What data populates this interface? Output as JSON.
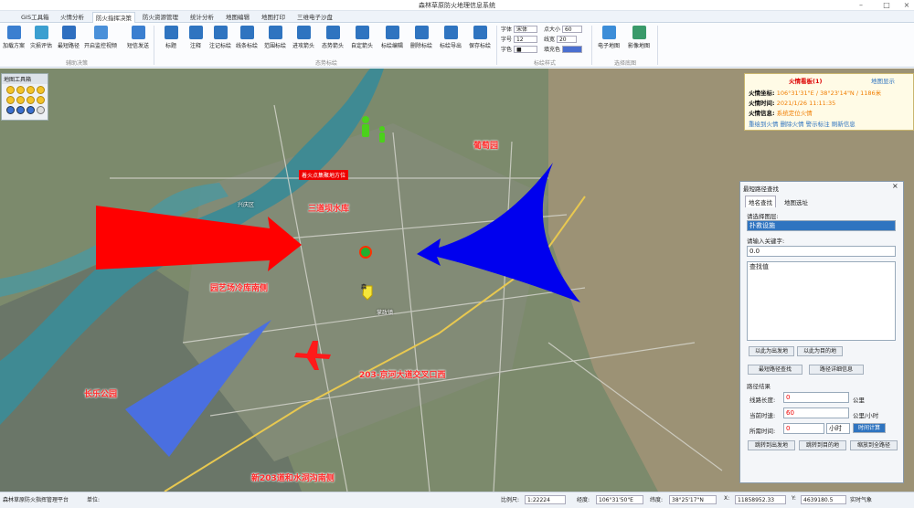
{
  "app_title": "森林草原防火地理信息系统",
  "tabs": [
    "GIS工具箱",
    "火情分析",
    "防火指挥决策",
    "防火资源管理",
    "统计分析",
    "地图编辑",
    "地图打印",
    "三维电子沙盘"
  ],
  "active_tab": 2,
  "ribbon": {
    "groups": [
      {
        "name": "辅助决策",
        "buttons": [
          "加载方案",
          "灾损评估",
          "最短路径",
          "开启监控视频",
          "短信发送"
        ]
      },
      {
        "name": "态势标绘",
        "buttons": [
          "标题",
          "注释",
          "注记标绘",
          "线条标绘",
          "范围标绘",
          "进攻箭头",
          "态势箭头",
          "自定箭头",
          "标绘编辑",
          "删除标绘",
          "标绘导出",
          "保存标绘"
        ]
      },
      {
        "name": "标绘样式",
        "fields": [
          {
            "label": "字体",
            "value": "宋体"
          },
          {
            "label": "字号",
            "value": "12"
          },
          {
            "label": "字色",
            "value": "■"
          },
          {
            "label": "点大小",
            "value": "60"
          },
          {
            "label": "线宽",
            "value": "20"
          },
          {
            "label": "填充色",
            "value": ""
          }
        ]
      },
      {
        "name": "选择底图",
        "buttons": [
          "电子地图",
          "影像地图"
        ]
      }
    ]
  },
  "toolbox_title": "地图工具箱",
  "map_labels": {
    "fire_alert": "着火点集聚地方位",
    "grape": "葡萄园",
    "reservoir": "三道坝水库",
    "garden_south": "园艺场冷库南侧",
    "intersection": "203-京河大道交叉口西",
    "park": "长乐公园",
    "new203": "新203道和水洞沟南侧",
    "district": "兴庆区",
    "town": "掌政镇",
    "forest_badge": "森"
  },
  "fire_info": {
    "title": "火情看板(1)",
    "link": "地图显示",
    "coord_label": "火情坐标:",
    "coord_value": "106°31'31\"E / 38°23'14\"N / 1186米",
    "time_label": "火情时间:",
    "time_value": "2021/1/26 11:11:35",
    "info_label": "火情信息:",
    "info_value": "系统定位火情",
    "actions": [
      "重绘到火情",
      "删除火情",
      "警示标注",
      "刷新信息"
    ]
  },
  "path_dialog": {
    "title": "最短路径查找",
    "tabs": [
      "地名查找",
      "地图选址"
    ],
    "layer_label": "请选择图层:",
    "layer_value": "扑救设施",
    "keyword_label": "请输入关键字:",
    "keyword_value": "0.0",
    "result_header": "查找值",
    "set_start": "以此为出发地",
    "set_end": "以此为目的地",
    "find_button": "最短路径查找",
    "detail_button": "路径详细信息",
    "result_title": "路径结果",
    "length_label": "线路长度:",
    "length_value": "0",
    "length_unit": "公里",
    "speed_label": "当前时速:",
    "speed_value": "60",
    "speed_unit": "公里/小时",
    "time_label": "所需时间:",
    "time_value": "0",
    "time_unit": "小时",
    "calc_button": "时间计算",
    "jump_start": "跳转到出发地",
    "jump_end": "跳转到目的地",
    "zoom_path": "缩放到全路径"
  },
  "status": {
    "org": "森林草原防火指挥管理平台",
    "unit_label": "单位:",
    "scale_label": "比例尺:",
    "scale_value": "1:22224",
    "lon_label": "经度:",
    "lon_value": "106°31'50\"E",
    "lat_label": "纬度:",
    "lat_value": "38°25'17\"N",
    "x_label": "X:",
    "x_value": "11858952.33",
    "y_label": "Y:",
    "y_value": "4639180.5",
    "weather": "实时气象"
  },
  "colors": {
    "accent": "#2f74c0",
    "fire": "#ff1a1a",
    "info": "#f07d00"
  }
}
